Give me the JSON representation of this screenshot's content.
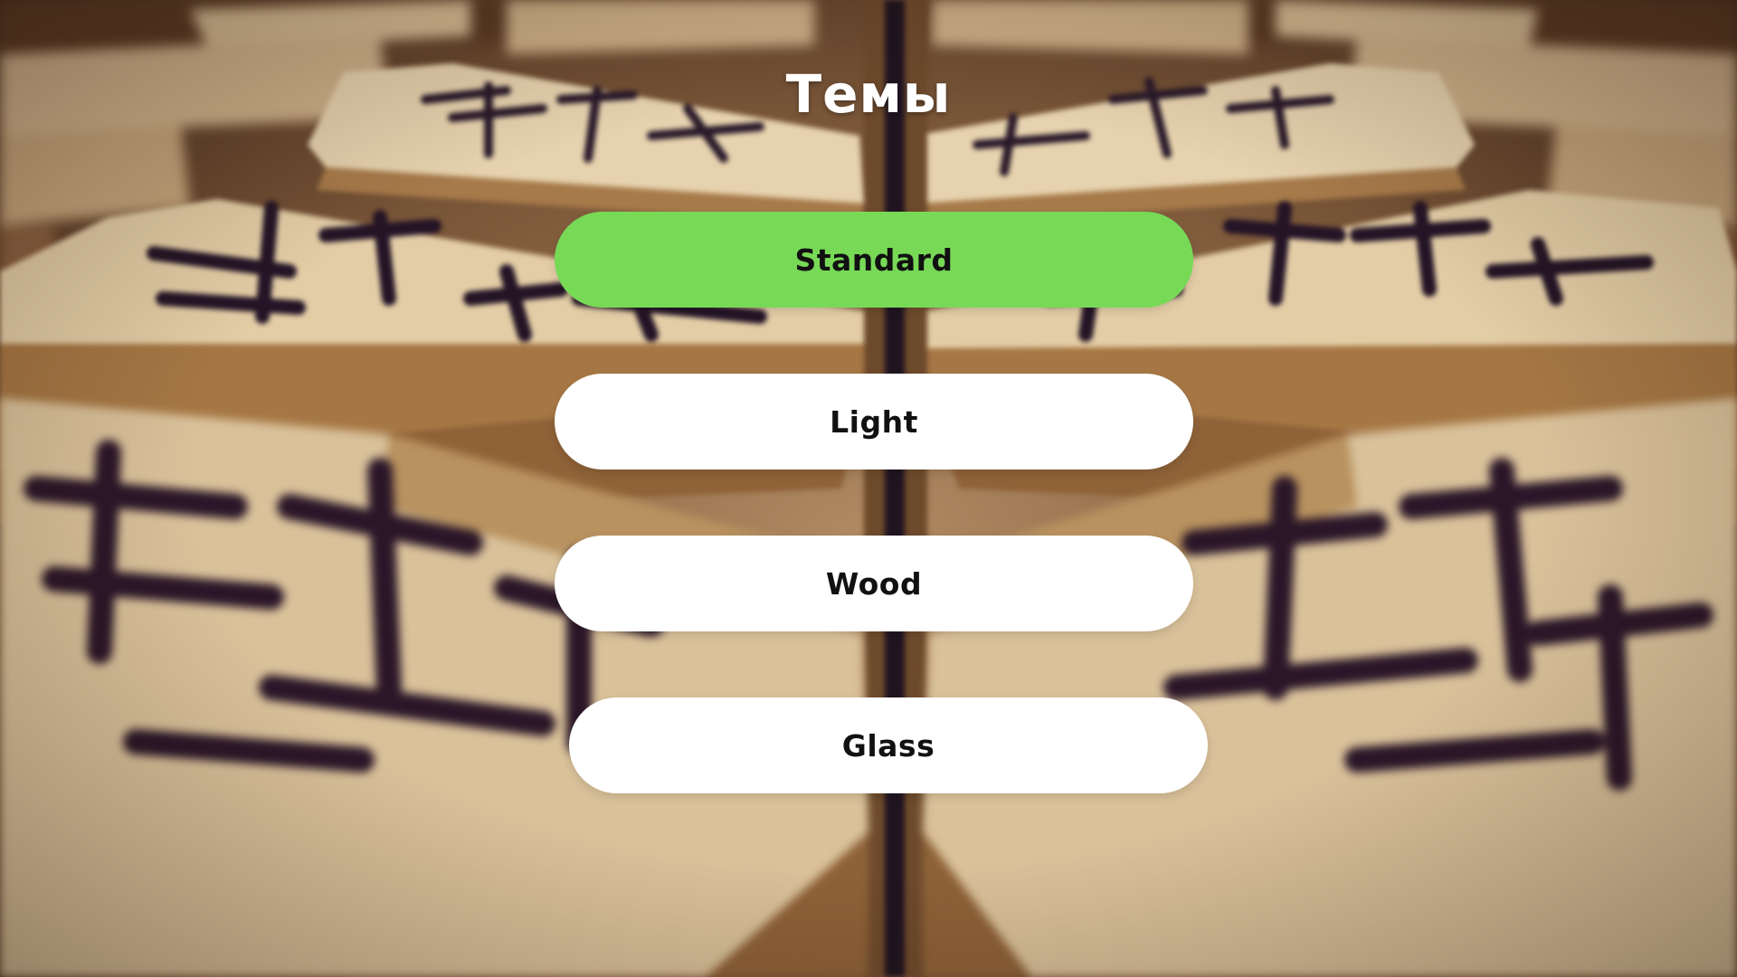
{
  "title": "Темы",
  "themes": [
    {
      "label": "Standard",
      "selected": true
    },
    {
      "label": "Light",
      "selected": false
    },
    {
      "label": "Wood",
      "selected": false
    },
    {
      "label": "Glass",
      "selected": false
    }
  ],
  "colors": {
    "selected": "#78d957",
    "button": "#ffffff",
    "title": "#ffffff",
    "button_text": "#111111"
  },
  "background": "shogi-pieces-photo"
}
